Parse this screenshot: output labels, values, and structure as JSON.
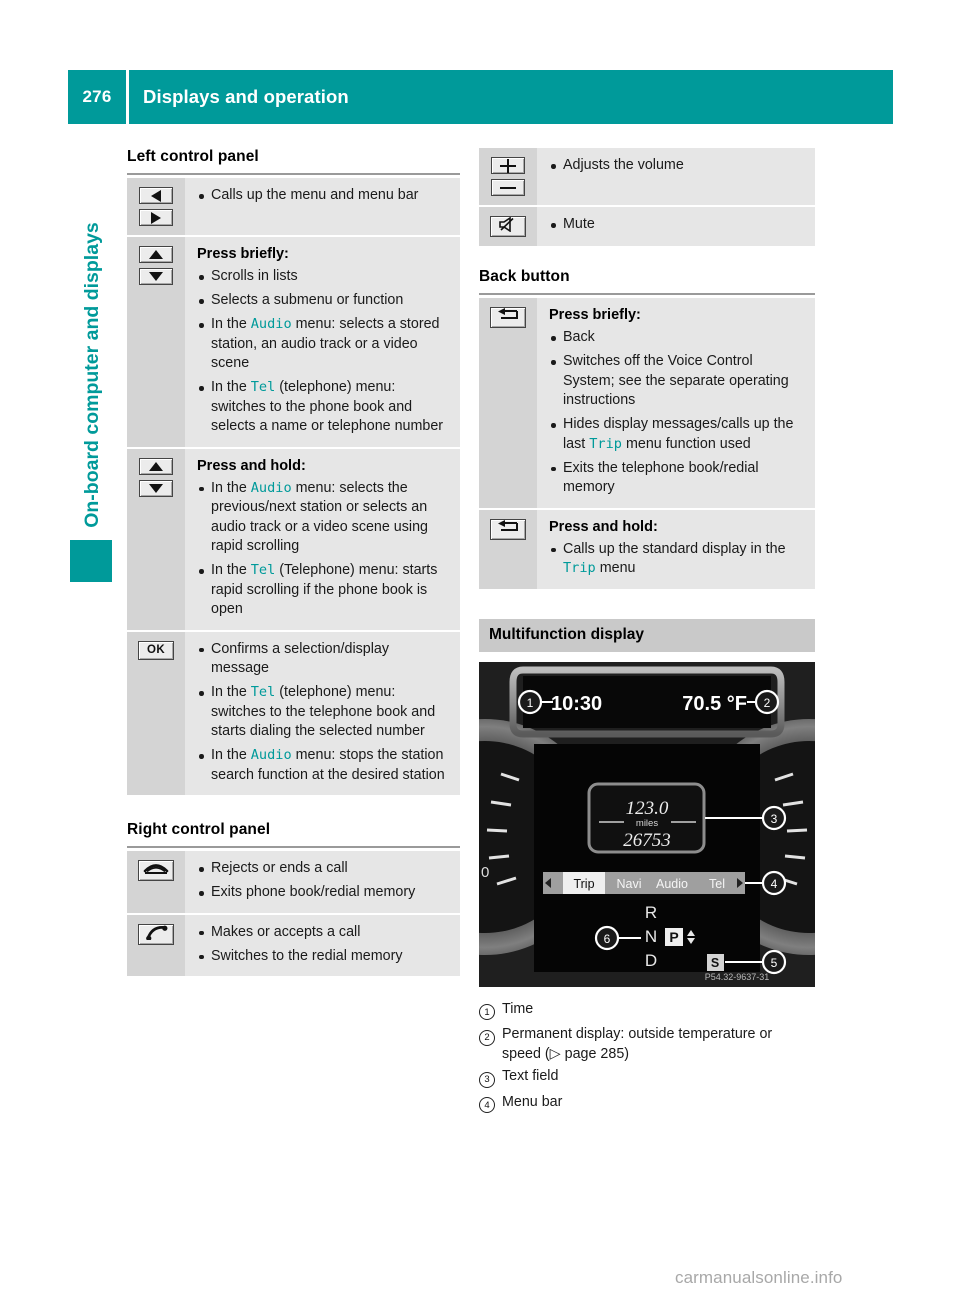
{
  "header": {
    "page_number": "276",
    "title": "Displays and operation"
  },
  "chapter_tab": {
    "label": "On-board computer and displays",
    "color": "#009a9a"
  },
  "left_column": {
    "section1_title": "Left control panel",
    "rows": [
      {
        "icons": [
          "arrow-left",
          "arrow-right"
        ],
        "subhead": "",
        "bullets": [
          [
            {
              "t": "Calls up the menu and menu bar",
              "m": false
            }
          ]
        ]
      },
      {
        "icons": [
          "arrow-up",
          "arrow-down"
        ],
        "subhead": "Press briefly:",
        "bullets": [
          [
            {
              "t": "Scrolls in lists",
              "m": false
            }
          ],
          [
            {
              "t": "Selects a submenu or function",
              "m": false
            }
          ],
          [
            {
              "t": "In the ",
              "m": false
            },
            {
              "t": "Audio",
              "m": true
            },
            {
              "t": " menu: selects a stored station, an audio track or a video scene",
              "m": false
            }
          ],
          [
            {
              "t": "In the ",
              "m": false
            },
            {
              "t": "Tel",
              "m": true
            },
            {
              "t": " (telephone) menu: switches to the phone book and selects a name or telephone number",
              "m": false
            }
          ]
        ]
      },
      {
        "icons": [
          "arrow-up",
          "arrow-down"
        ],
        "subhead": "Press and hold:",
        "bullets": [
          [
            {
              "t": "In the ",
              "m": false
            },
            {
              "t": "Audio",
              "m": true
            },
            {
              "t": " menu: selects the previous/next station or selects an audio track or a video scene using rapid scrolling",
              "m": false
            }
          ],
          [
            {
              "t": "In the ",
              "m": false
            },
            {
              "t": "Tel",
              "m": true
            },
            {
              "t": " (Telephone) menu: starts rapid scrolling if the phone book is open",
              "m": false
            }
          ]
        ]
      },
      {
        "icons": [
          "ok-button"
        ],
        "subhead": "",
        "bullets": [
          [
            {
              "t": "Confirms a selection/display message",
              "m": false
            }
          ],
          [
            {
              "t": "In the ",
              "m": false
            },
            {
              "t": "Tel",
              "m": true
            },
            {
              "t": " (telephone) menu: switches to the telephone book and starts dialing the selected number",
              "m": false
            }
          ],
          [
            {
              "t": "In the ",
              "m": false
            },
            {
              "t": "Audio",
              "m": true
            },
            {
              "t": " menu: stops the station search function at the desired station",
              "m": false
            }
          ]
        ]
      }
    ],
    "section2_title": "Right control panel",
    "rows2": [
      {
        "icons": [
          "phone-hangup"
        ],
        "subhead": "",
        "bullets": [
          [
            {
              "t": "Rejects or ends a call",
              "m": false
            }
          ],
          [
            {
              "t": "Exits phone book/redial memory",
              "m": false
            }
          ]
        ]
      },
      {
        "icons": [
          "phone-call"
        ],
        "subhead": "",
        "bullets": [
          [
            {
              "t": "Makes or accepts a call",
              "m": false
            }
          ],
          [
            {
              "t": "Switches to the redial memory",
              "m": false
            }
          ]
        ]
      }
    ]
  },
  "right_column": {
    "rows_top": [
      {
        "icons": [
          "plus-button",
          "minus-button"
        ],
        "subhead": "",
        "bullets": [
          [
            {
              "t": "Adjusts the volume",
              "m": false
            }
          ]
        ]
      },
      {
        "icons": [
          "mute-button"
        ],
        "subhead": "",
        "bullets": [
          [
            {
              "t": "Mute",
              "m": false
            }
          ]
        ]
      }
    ],
    "section_back_title": "Back button",
    "rows_back": [
      {
        "icons": [
          "back-button"
        ],
        "subhead": "Press briefly:",
        "bullets": [
          [
            {
              "t": "Back",
              "m": false
            }
          ],
          [
            {
              "t": "Switches off the Voice Control System; see the separate operating instructions",
              "m": false
            }
          ],
          [
            {
              "t": "Hides display messages/calls up the last ",
              "m": false
            },
            {
              "t": "Trip",
              "m": true
            },
            {
              "t": " menu function used",
              "m": false
            }
          ],
          [
            {
              "t": "Exits the telephone book/redial memory",
              "m": false
            }
          ]
        ]
      },
      {
        "icons": [
          "back-button"
        ],
        "subhead": "Press and hold:",
        "bullets": [
          [
            {
              "t": "Calls up the standard display in the ",
              "m": false
            },
            {
              "t": "Trip",
              "m": true
            },
            {
              "t": " menu",
              "m": false
            }
          ]
        ]
      }
    ],
    "multifunction_bar": "Multifunction display",
    "photo": {
      "time": "10:30",
      "temperature": "70.5 °F",
      "trip_distance": "123.0",
      "trip_unit": "miles",
      "odometer": "26753",
      "menu_items": [
        "Trip",
        "Navi",
        "Audio",
        "Tel"
      ],
      "selected_menu": "Trip",
      "gear_letters": [
        "R",
        "N",
        "D"
      ],
      "gear_selected": "P",
      "sport_badge": "S",
      "callouts": [
        "1",
        "2",
        "3",
        "4",
        "5",
        "6"
      ],
      "photo_code": "P54.32-9637-31"
    },
    "legend": [
      {
        "num": "1",
        "text": "Time"
      },
      {
        "num": "2",
        "text": "Permanent display: outside temperature or speed (▷ page 285)"
      },
      {
        "num": "3",
        "text": "Text field"
      },
      {
        "num": "4",
        "text": "Menu bar"
      }
    ]
  },
  "watermark": "carmanualsonline.info"
}
